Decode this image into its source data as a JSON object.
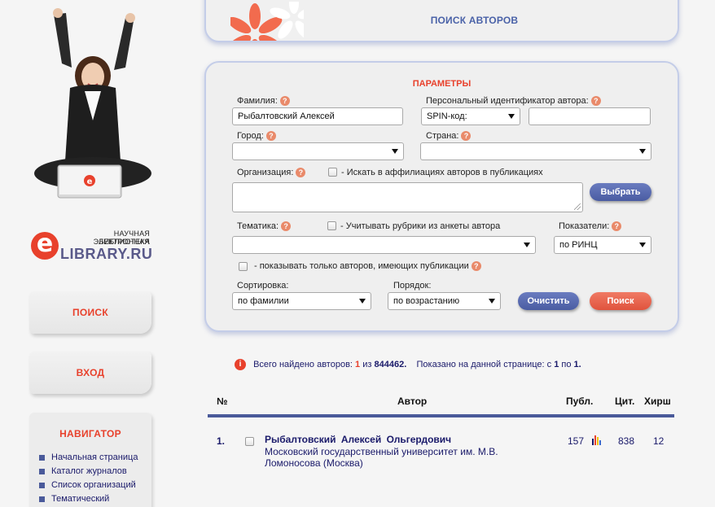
{
  "sidebar": {
    "logo": {
      "line1": "НАУЧНАЯ ЭЛЕКТРОННАЯ",
      "line2": "БИБЛИОТЕКА",
      "brand": "LIBRARY.RU",
      "letter": "e"
    },
    "search_button": "ПОИСК",
    "login_button": "ВХОД",
    "navigator": {
      "title": "НАВИГАТОР",
      "items": [
        "Начальная страница",
        "Каталог журналов",
        "Список организаций",
        "Тематический рубрикатор"
      ]
    }
  },
  "header": {
    "title": "ПОИСК АВТОРОВ"
  },
  "params": {
    "title": "ПАРАМЕТРЫ",
    "surname_label": "Фамилия:",
    "surname_value": "Рыбалтовский Алексей",
    "author_id_label": "Персональный идентификатор автора:",
    "author_id_type": "SPIN-код:",
    "author_id_value": "",
    "city_label": "Город:",
    "city_value": "",
    "country_label": "Страна:",
    "country_value": "",
    "org_label": "Организация:",
    "affiliation_label": "- Искать в аффилиациях авторов в публикациях",
    "select_button": "Выбрать",
    "topic_label": "Тематика:",
    "topic_checkbox_label": "- Учитывать рубрики из анкеты автора",
    "topic_value": "",
    "indicators_label": "Показатели:",
    "indicators_value": "по РИНЦ",
    "only_with_pubs_label": "- показывать только авторов, имеющих публикации",
    "sort_label": "Сортировка:",
    "sort_value": "по фамилии",
    "order_label": "Порядок:",
    "order_value": "по возрастанию",
    "clear_button": "Очистить",
    "search_button": "Поиск",
    "help_glyph": "?"
  },
  "results": {
    "found_prefix": "Всего найдено авторов:",
    "found_count": "1",
    "found_of": "из",
    "found_total": "844462.",
    "shown_prefix": "Показано на данной странице: с",
    "shown_from": "1",
    "shown_to_word": "по",
    "shown_to": "1.",
    "info_glyph": "i",
    "columns": {
      "num": "№",
      "author": "Автор",
      "pubs": "Публ.",
      "cites": "Цит.",
      "hirsch": "Хирш"
    },
    "rows": [
      {
        "num": "1.",
        "name": "Рыбалтовский Алексей Ольгердович",
        "org": "Московский государственный университет им. М.В. Ломоносова (Москва)",
        "pubs": "157",
        "cites": "838",
        "hirsch": "12"
      }
    ]
  },
  "colors": {
    "accent_red": "#e8412c",
    "accent_blue": "#4a5a9a",
    "link_blue": "#1a1a6a"
  }
}
